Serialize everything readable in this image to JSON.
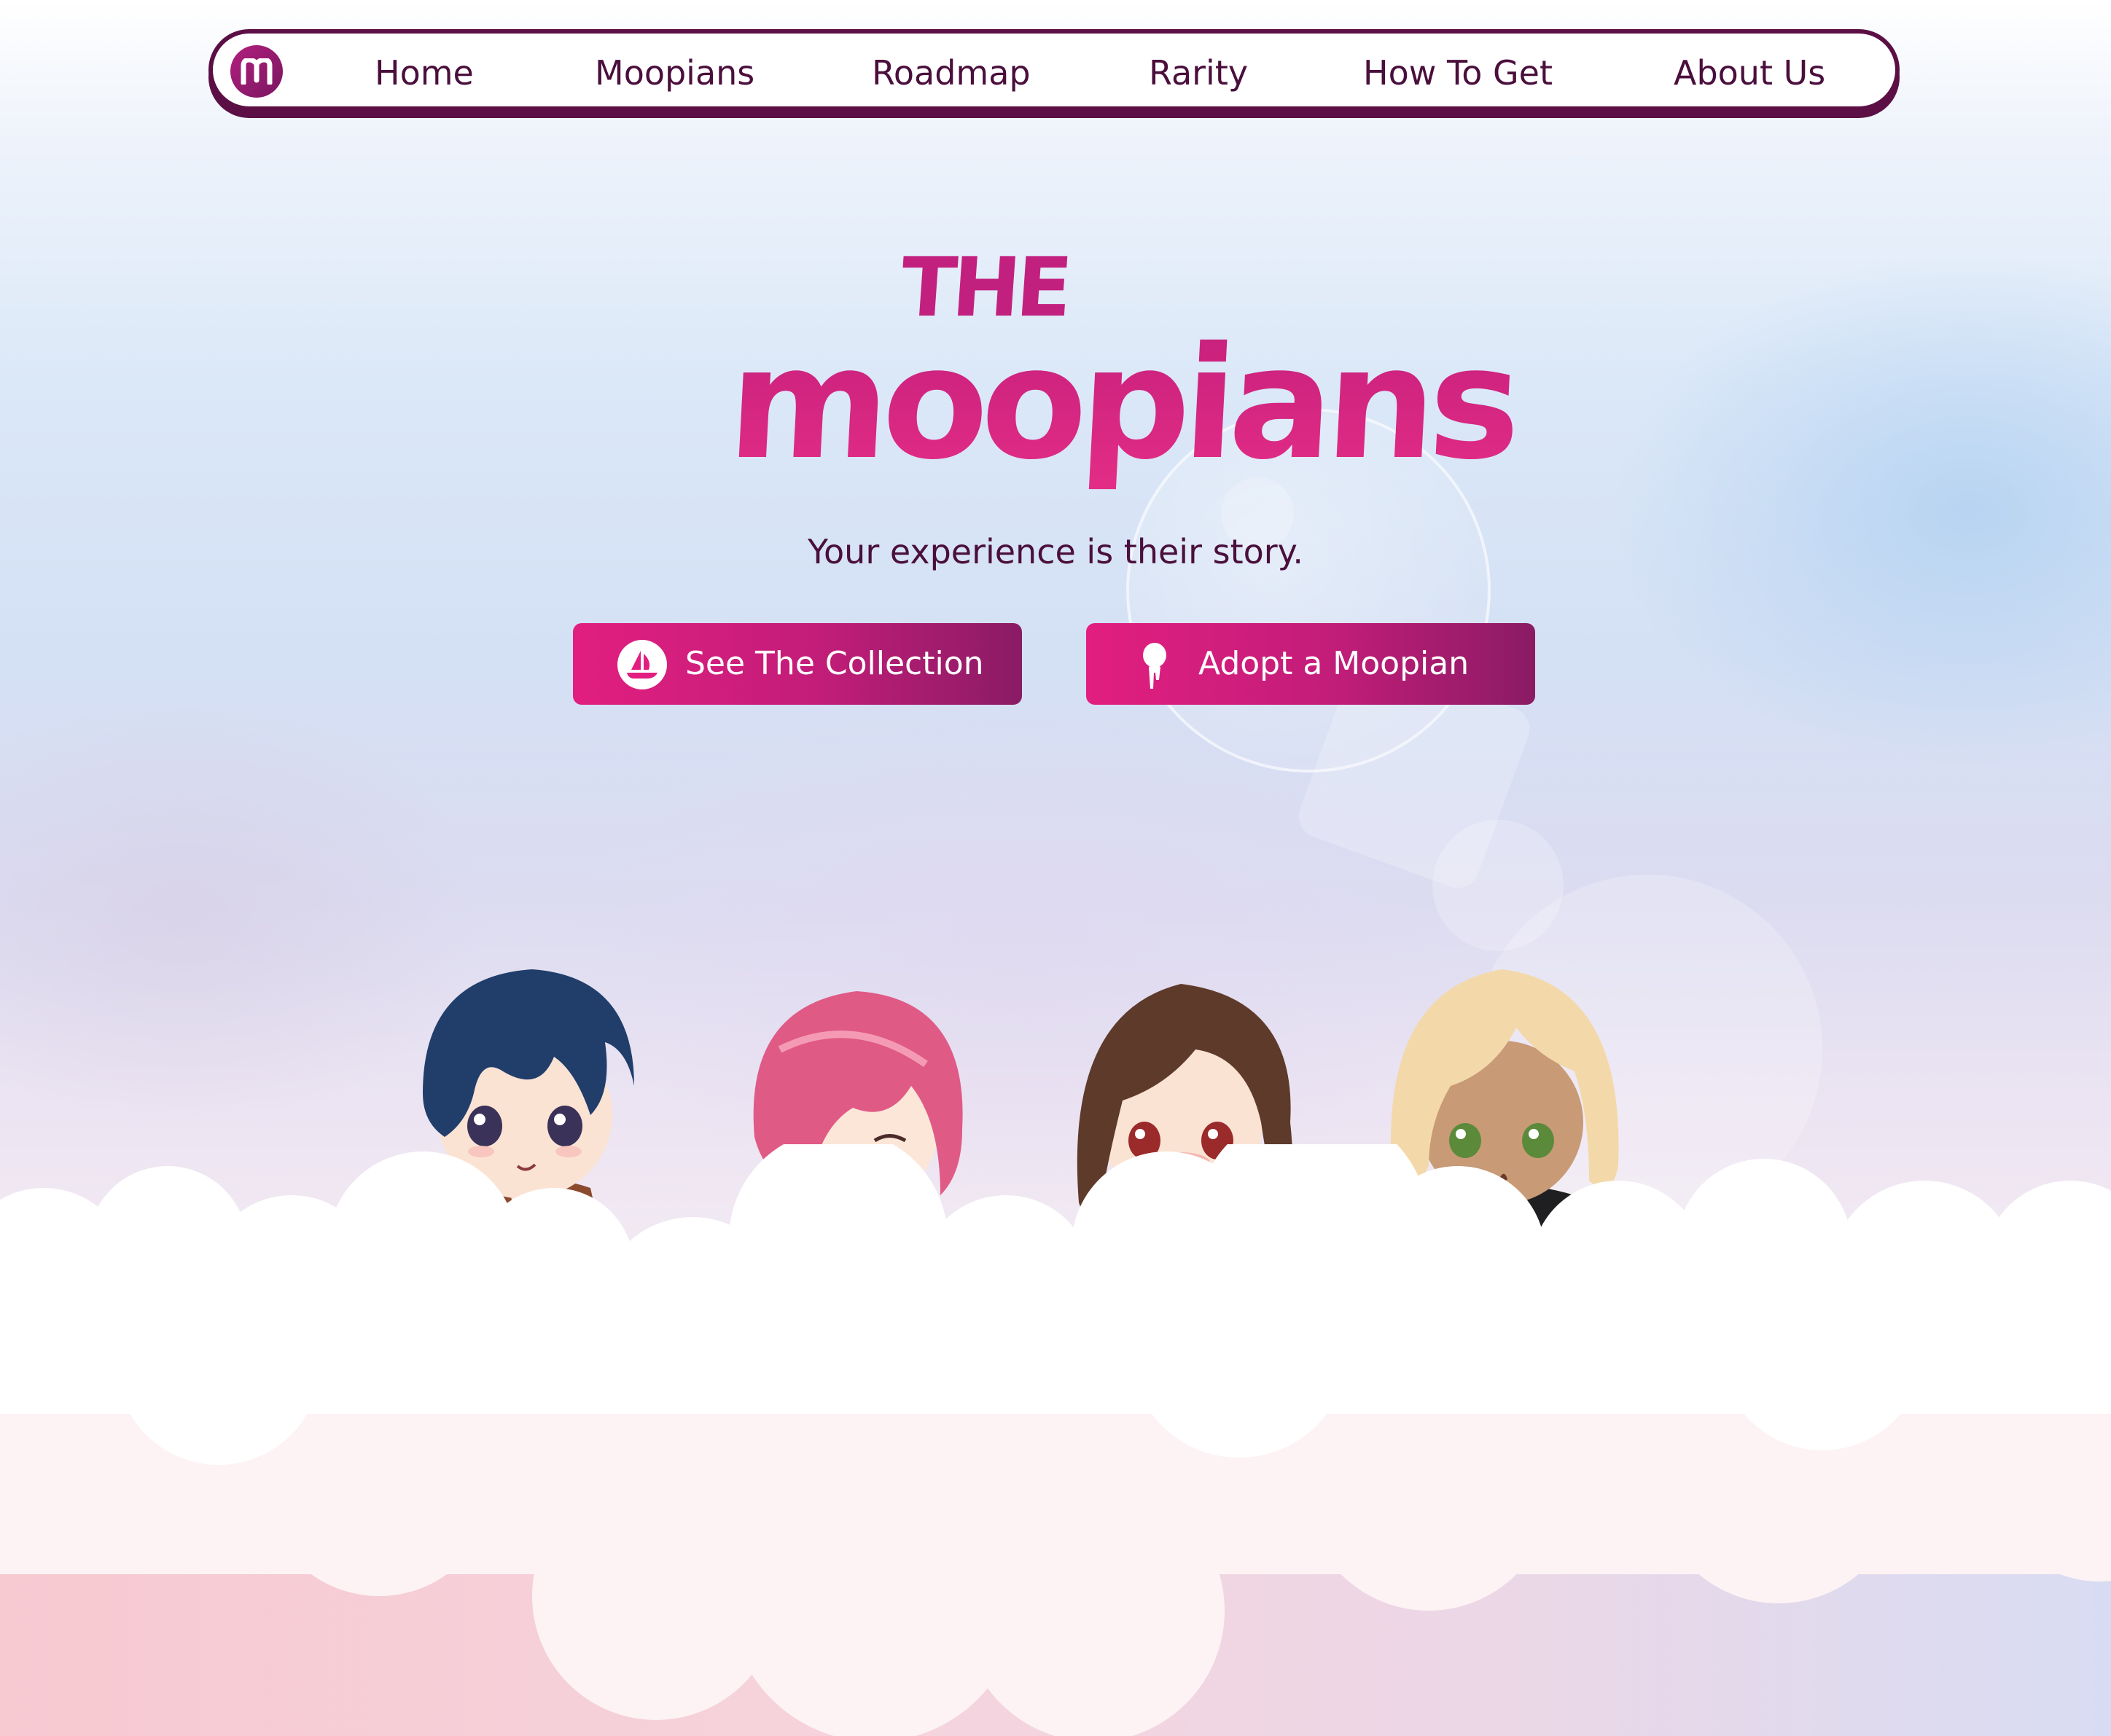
{
  "nav": {
    "logo_letter": "m",
    "items": [
      {
        "label": "Home"
      },
      {
        "label": "Moopians"
      },
      {
        "label": "Roadmap"
      },
      {
        "label": "Rarity"
      },
      {
        "label": "How To Get"
      },
      {
        "label": "About Us"
      }
    ]
  },
  "hero": {
    "logo_the": "THE",
    "logo_main": "moopians",
    "tagline": "Your experience is their story.",
    "buttons": [
      {
        "label": "See The Collection",
        "icon": "opensea-boat-icon"
      },
      {
        "label": "Adopt a Moopian",
        "icon": "moopian-figure-icon"
      }
    ]
  },
  "characters": [
    {
      "name": "navy-haired-boy",
      "hair": "#213e6b",
      "top": "#8b4a2e"
    },
    {
      "name": "pink-haired-girl",
      "hair": "#e05a86",
      "top": "#ffffff"
    },
    {
      "name": "brown-haired-girl",
      "hair": "#5e3a2a",
      "top": "#b0262e"
    },
    {
      "name": "blonde-haired-girl",
      "hair": "#f3d9a9",
      "top": "#1f1f22"
    }
  ],
  "colors": {
    "brand_dark": "#5b0f45",
    "brand_pink": "#e21e80",
    "brand_purple": "#8a1b64",
    "text_dark": "#4a0f3c"
  }
}
